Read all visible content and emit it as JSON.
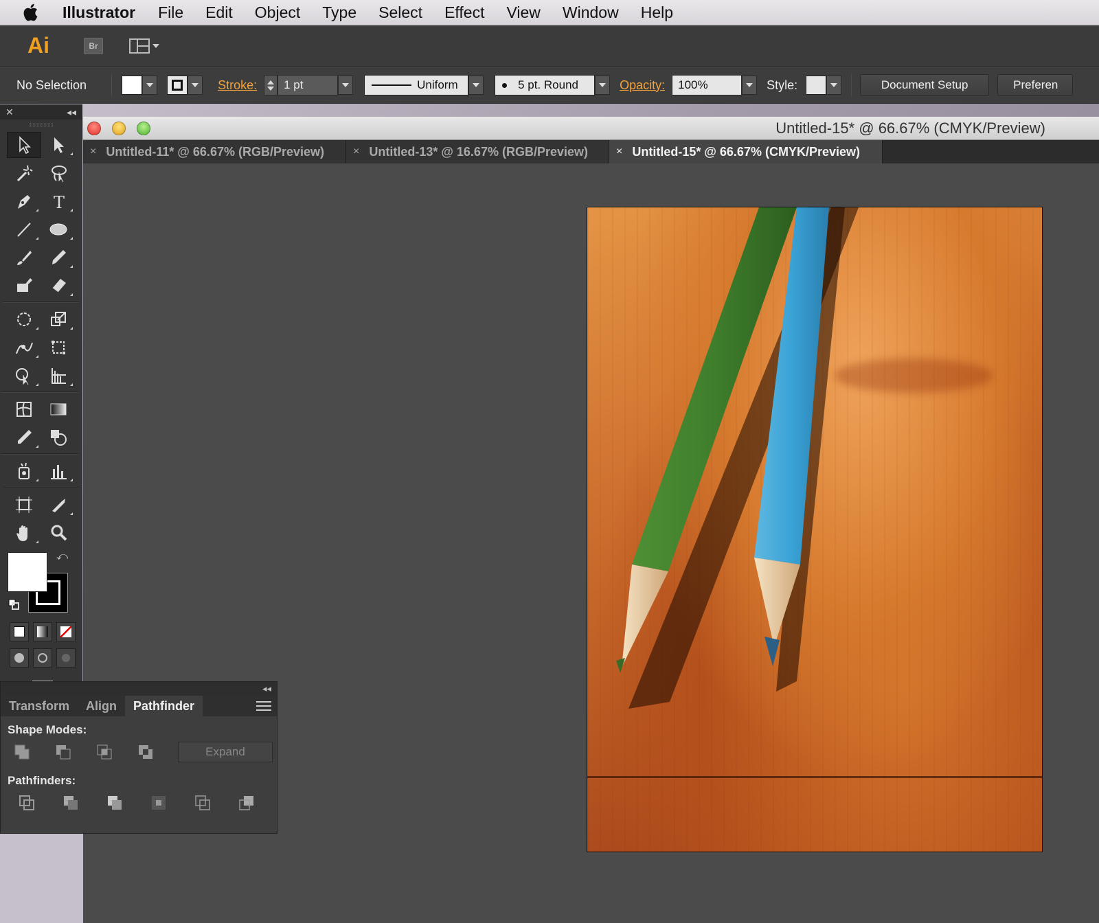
{
  "menubar": {
    "app_name": "Illustrator",
    "items": [
      "File",
      "Edit",
      "Object",
      "Type",
      "Select",
      "Effect",
      "View",
      "Window",
      "Help"
    ]
  },
  "appbar": {
    "logo": "Ai",
    "bridge_label": "Br"
  },
  "controlbar": {
    "selection_status": "No Selection",
    "stroke_label": "Stroke:",
    "stroke_weight": "1 pt",
    "stroke_profile": "Uniform",
    "brush": "5 pt. Round",
    "opacity_label": "Opacity:",
    "opacity_value": "100%",
    "style_label": "Style:",
    "document_setup": "Document Setup",
    "preferences": "Preferen"
  },
  "document": {
    "window_title": "Untitled-15* @ 66.67% (CMYK/Preview)",
    "tabs": [
      {
        "label": "Untitled-11* @ 66.67% (RGB/Preview)",
        "active": false
      },
      {
        "label": "Untitled-13* @ 16.67% (RGB/Preview)",
        "active": false
      },
      {
        "label": "Untitled-15* @ 66.67% (CMYK/Preview)",
        "active": true
      }
    ],
    "tab_close": "×"
  },
  "pathfinder_panel": {
    "tabs": [
      "Transform",
      "Align",
      "Pathfinder"
    ],
    "active_tab": "Pathfinder",
    "shape_modes_label": "Shape Modes:",
    "expand_label": "Expand",
    "pathfinders_label": "Pathfinders:"
  },
  "colors": {
    "accent_orange": "#f3a33a",
    "fill": "#ffffff",
    "stroke": "#000000"
  }
}
